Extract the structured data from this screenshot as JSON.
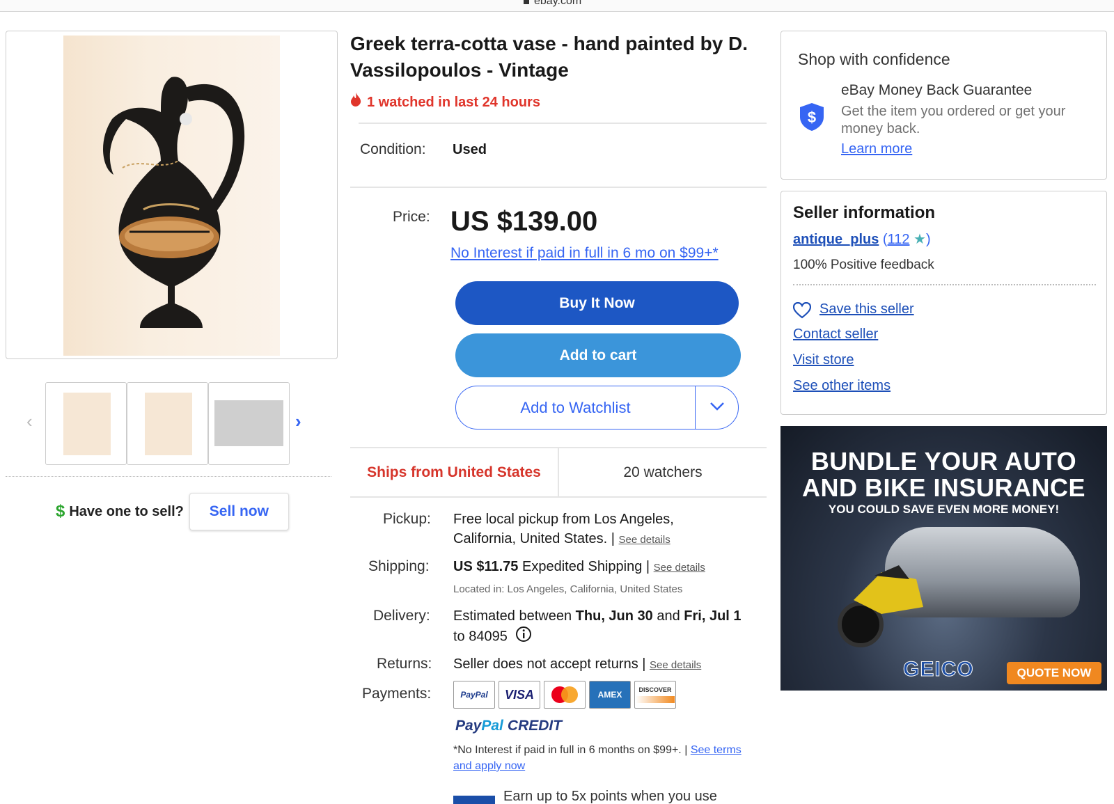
{
  "browser": {
    "url": "ebay.com"
  },
  "gallery": {
    "prev_arrow": "‹",
    "next_arrow": "›",
    "thumbnails": [
      "thumbnail-1",
      "thumbnail-2",
      "thumbnail-3"
    ],
    "sell_prompt": "Have one to sell?",
    "sell_button": "Sell now"
  },
  "listing": {
    "title": "Greek terra-cotta vase - hand painted by D. Vassilopoulos - Vintage",
    "watched": "1 watched in last 24 hours",
    "condition_label": "Condition:",
    "condition_value": "Used",
    "price_label": "Price:",
    "price": "US $139.00",
    "financing": "No Interest if paid in full in 6 mo on $99+*",
    "buy_now": "Buy It Now",
    "add_to_cart": "Add to cart",
    "add_to_watchlist": "Add to Watchlist",
    "ships_from": "Ships from United States",
    "watchers": "20 watchers",
    "pickup_label": "Pickup:",
    "pickup_text": "Free local pickup from Los Angeles, California, United States. |",
    "see_details": "See details",
    "shipping_label": "Shipping:",
    "shipping_price": "US $11.75",
    "shipping_method": "Expedited Shipping |",
    "located_in": "Located in: Los Angeles, California, United States",
    "delivery_label": "Delivery:",
    "delivery_prefix": "Estimated between",
    "delivery_start": "Thu, Jun 30",
    "delivery_and": "and",
    "delivery_end": "Fri, Jul 1",
    "delivery_zip": "to 84095",
    "returns_label": "Returns:",
    "returns_text": "Seller does not accept returns |",
    "payments_label": "Payments:",
    "payment_methods": [
      "PayPal",
      "VISA",
      "Mastercard",
      "AMEX",
      "DISCOVER"
    ],
    "paypal_credit_1": "Pay",
    "paypal_credit_2": "Pal",
    "paypal_credit_3": "CREDIT",
    "terms_text": "*No Interest if paid in full in 6 months on $99+. |",
    "terms_link": "See terms and apply now",
    "earn_text": "Earn up to 5x points when you use"
  },
  "confidence": {
    "heading": "Shop with confidence",
    "guarantee_title": "eBay Money Back Guarantee",
    "guarantee_desc": "Get the item you ordered or get your money back.",
    "learn_more": "Learn more"
  },
  "seller": {
    "heading": "Seller information",
    "name": "antique_plus",
    "open_paren": " (",
    "feedback_count": "112",
    "close_paren": ")",
    "feedback": "100% Positive feedback",
    "save": "Save this seller",
    "contact": "Contact seller",
    "visit": "Visit store",
    "other": "See other items"
  },
  "ad": {
    "headline": "BUNDLE YOUR AUTO AND BIKE INSURANCE",
    "subhead": "YOU COULD SAVE EVEN MORE MONEY!",
    "brand": "GEICO",
    "cta": "QUOTE NOW"
  },
  "colors": {
    "link": "#3665f3",
    "buy_now": "#1d57c4",
    "add_to_cart": "#3b95da",
    "alert_red": "#e0352b"
  }
}
